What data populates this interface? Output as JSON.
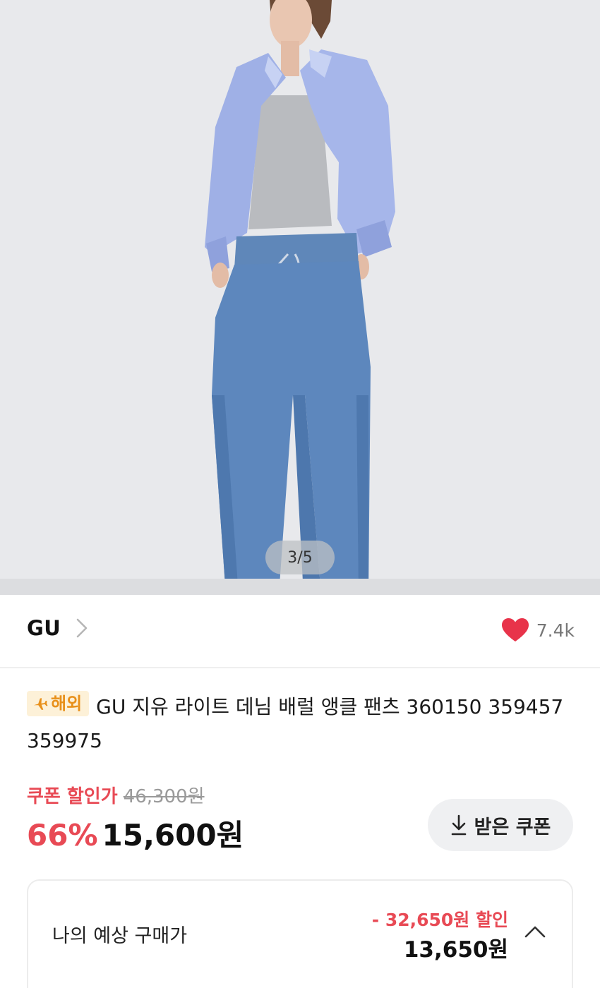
{
  "gallery": {
    "indicator": "3/5",
    "current_page": 3,
    "total_pages": 5
  },
  "brand": {
    "name": "GU",
    "like_count": "7.4k",
    "liked": true,
    "heart_color": "#e8334a"
  },
  "product": {
    "badge": "해외",
    "badge_icon": "plane-icon",
    "title": "GU 지유 라이트 데님 배럴 앵클 팬츠 360150 359457 359975"
  },
  "price": {
    "coupon_label": "쿠폰 할인가",
    "original_price": "46,300원",
    "discount_rate": "66%",
    "sale_price": "15,600원",
    "accent_color": "#e84a55"
  },
  "coupon_button": {
    "label": "받은 쿠폰",
    "icon": "download-icon"
  },
  "expected": {
    "label": "나의 예상 구매가",
    "discount": "- 32,650원 할인",
    "price": "13,650원"
  }
}
